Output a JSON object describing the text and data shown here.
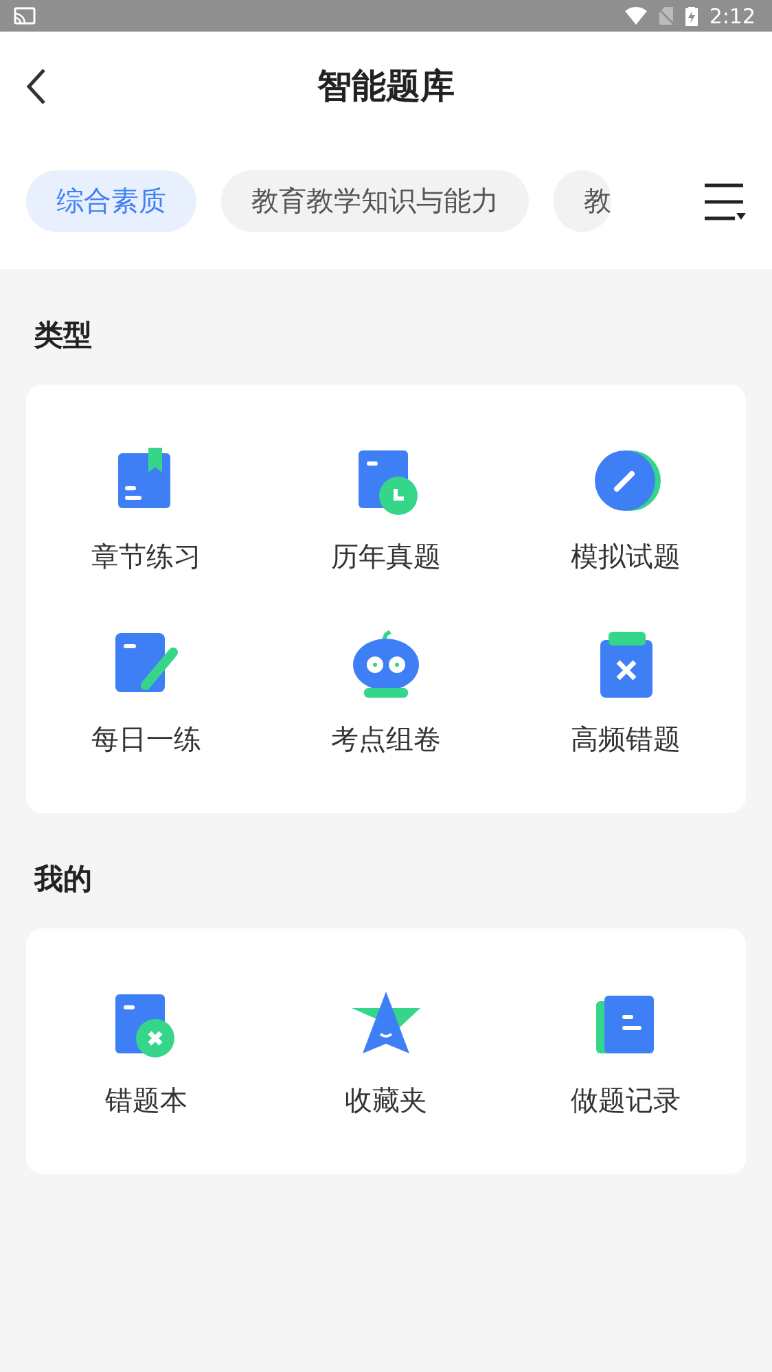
{
  "status_bar": {
    "time": "2:12"
  },
  "header": {
    "title": "智能题库"
  },
  "tabs": [
    {
      "label": "综合素质",
      "selected": true
    },
    {
      "label": "教育教学知识与能力",
      "selected": false
    },
    {
      "label": "教",
      "selected": false
    }
  ],
  "sections": [
    {
      "title": "类型",
      "items": [
        {
          "label": "章节练习",
          "kind": "book"
        },
        {
          "label": "历年真题",
          "kind": "clock"
        },
        {
          "label": "模拟试题",
          "kind": "pen-circle"
        },
        {
          "label": "每日一练",
          "kind": "note"
        },
        {
          "label": "考点组卷",
          "kind": "robot"
        },
        {
          "label": "高频错题",
          "kind": "clipboard"
        }
      ]
    },
    {
      "title": "我的",
      "items": [
        {
          "label": "错题本",
          "kind": "wrong"
        },
        {
          "label": "收藏夹",
          "kind": "star"
        },
        {
          "label": "做题记录",
          "kind": "record"
        }
      ]
    }
  ]
}
